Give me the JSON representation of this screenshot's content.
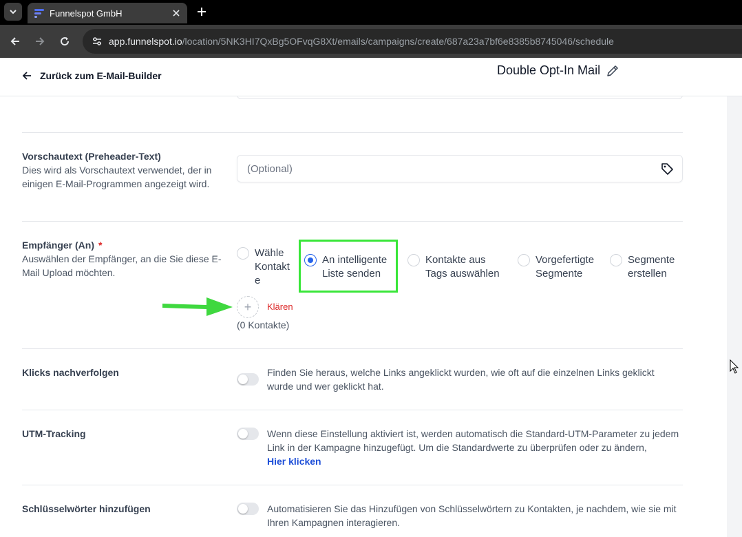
{
  "browser": {
    "tab_title": "Funnelspot GmbH",
    "url_host": "app.funnelspot.io",
    "url_path": "/location/5NK3HI7QxBg5OFvqG8Xt/emails/campaigns/create/687a23a7bf6e8385b8745046/schedule"
  },
  "header": {
    "back_label": "Zurück zum E-Mail-Builder",
    "mail_title": "Double Opt-In Mail"
  },
  "preheader": {
    "label": "Vorschautext (Preheader-Text)",
    "help": "Dies wird als Vorschautext verwendet, der in einigen E-Mail-Programmen angezeigt wird.",
    "placeholder": "(Optional)"
  },
  "recipients": {
    "label": "Empfänger (An)",
    "required_mark": "*",
    "help": "Auswählen der Empfänger, an die Sie diese E-Mail Upload möchten.",
    "options": [
      {
        "label": "Wähle Kontakt e",
        "checked": false
      },
      {
        "label": "An intelligente Liste senden",
        "checked": true
      },
      {
        "label": "Kontakte aus Tags auswählen",
        "checked": false
      },
      {
        "label": "Vorgefertigte Segmente",
        "checked": false
      },
      {
        "label": "Segmente erstellen",
        "checked": false
      }
    ],
    "add_symbol": "+",
    "clear_label": "Klären",
    "count_label": "(0 Kontakte)"
  },
  "click_tracking": {
    "label": "Klicks nachverfolgen",
    "description": "Finden Sie heraus, welche Links angeklickt wurden, wie oft auf die einzelnen Links geklickt wurde und wer geklickt hat.",
    "enabled": false
  },
  "utm_tracking": {
    "label": "UTM-Tracking",
    "description": "Wenn diese Einstellung aktiviert ist, werden automatisch die Standard-UTM-Parameter zu jedem Link in der Kampagne hinzugefügt. Um die Standardwerte zu überprüfen oder zu ändern,",
    "link_label": "Hier klicken",
    "enabled": false
  },
  "keywords": {
    "label": "Schlüsselwörter hinzufügen",
    "description": "Automatisieren Sie das Hinzufügen von Schlüsselwörtern zu Kontakten, je nachdem, wie sie mit Ihren Kampagnen interagieren.",
    "enabled": false
  },
  "colors": {
    "accent": "#2563eb",
    "highlight": "#39e639",
    "danger": "#dc2626",
    "link": "#1d4ed8"
  }
}
